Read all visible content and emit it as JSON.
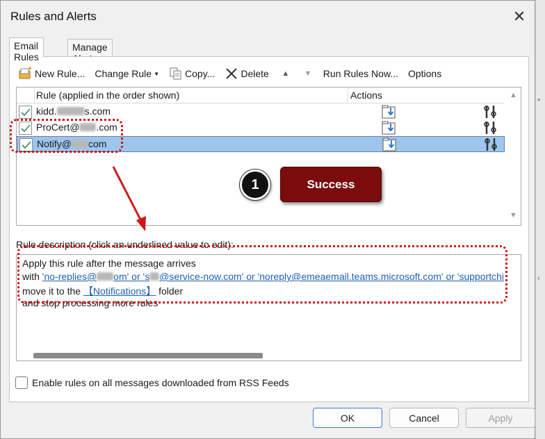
{
  "window": {
    "title": "Rules and Alerts",
    "close_label": "✕"
  },
  "tabs": [
    {
      "label": "Email Rules",
      "active": true
    },
    {
      "label": "Manage Alerts",
      "active": false
    }
  ],
  "toolbar": {
    "new_rule": "New Rule...",
    "change_rule": "Change Rule",
    "copy": "Copy...",
    "delete": "Delete",
    "run_rules_now": "Run Rules Now...",
    "options": "Options"
  },
  "rules_list": {
    "col_rule": "Rule (applied in the order shown)",
    "col_actions": "Actions",
    "rows": [
      {
        "name_prefix": "kidd.",
        "name_suffix": "s.com",
        "checked": true,
        "selected": false
      },
      {
        "name_prefix": "ProCert@",
        "name_suffix": ".com",
        "checked": true,
        "selected": false
      },
      {
        "name_prefix": "Notify@",
        "name_suffix": "com",
        "checked": true,
        "selected": true
      }
    ]
  },
  "annotation": {
    "step_number": "1",
    "success_label": "Success",
    "colors": {
      "dotted_outline": "#d01818",
      "success_bg": "#7a0c0c"
    }
  },
  "description": {
    "label": "Rule description (click an underlined value to edit):",
    "line1": "Apply this rule after the message arrives",
    "line2_prefix": "with ",
    "line2_link1": "'no-replies@",
    "line2_link1_end": "om' or 's",
    "line2_link2": "@service-now.com' or 'noreply@emeaemail.teams.microsoft.com' or 'supportchi",
    "line3_prefix": "move it to the ",
    "line3_link": "【Notifications】",
    "line3_suffix": " folder",
    "line4": "  and stop processing more rules"
  },
  "rss_option": {
    "label": "Enable rules on all messages downloaded from RSS Feeds",
    "checked": false
  },
  "buttons": {
    "ok": "OK",
    "cancel": "Cancel",
    "apply": "Apply"
  },
  "icons": [
    "new-rule-icon",
    "copy-icon",
    "delete-icon",
    "move-up-icon",
    "move-down-icon",
    "checkmark-icon",
    "move-to-folder-icon",
    "rule-settings-icon",
    "close-icon"
  ]
}
